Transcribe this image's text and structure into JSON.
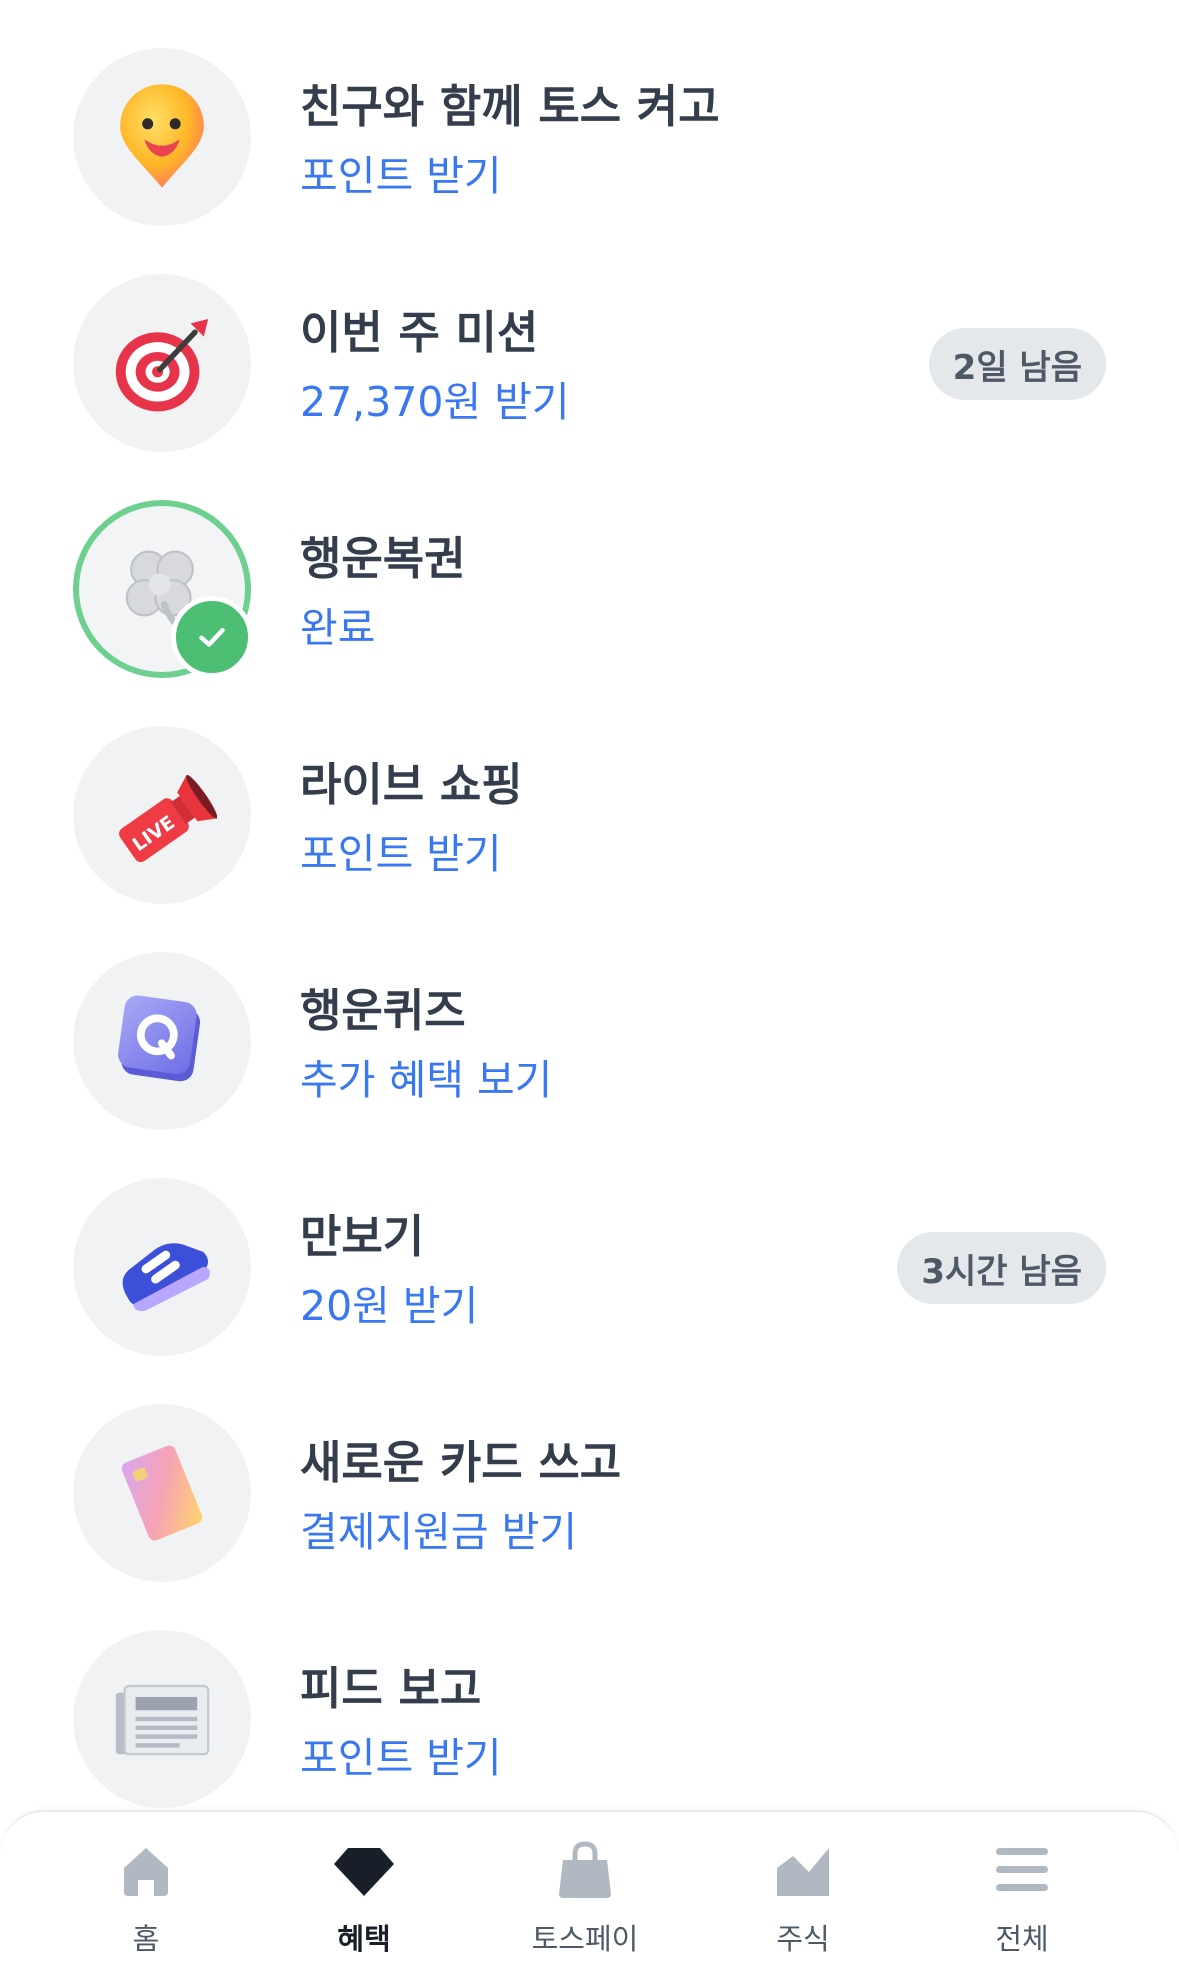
{
  "benefits": [
    {
      "title": "친구와 함께 토스 켜고",
      "subtitle": "포인트 받기",
      "icon": "smile-pin-icon"
    },
    {
      "title": "이번 주 미션",
      "subtitle": "27,370원 받기",
      "badge": "2일 남음",
      "icon": "target-icon"
    },
    {
      "title": "행운복권",
      "subtitle": "완료",
      "icon": "clover-icon",
      "completed": true
    },
    {
      "title": "라이브 쇼핑",
      "subtitle": "포인트 받기",
      "icon": "live-megaphone-icon"
    },
    {
      "title": "행운퀴즈",
      "subtitle": "추가 혜택 보기",
      "icon": "quiz-cube-icon"
    },
    {
      "title": "만보기",
      "subtitle": "20원 받기",
      "badge": "3시간 남음",
      "icon": "sneaker-icon"
    },
    {
      "title": "새로운 카드 쓰고",
      "subtitle": "결제지원금 받기",
      "icon": "card-icon"
    },
    {
      "title": "피드 보고",
      "subtitle": "포인트 받기",
      "icon": "newspaper-icon"
    }
  ],
  "tabbar": {
    "items": [
      {
        "label": "홈",
        "icon": "home-icon"
      },
      {
        "label": "혜택",
        "icon": "diamond-icon",
        "active": true
      },
      {
        "label": "토스페이",
        "icon": "shopping-bag-icon"
      },
      {
        "label": "주식",
        "icon": "chart-icon"
      },
      {
        "label": "전체",
        "icon": "menu-icon"
      }
    ]
  },
  "colors": {
    "accent": "#3a78f2",
    "title": "#333d4b",
    "badge_bg": "#e5e8eb",
    "complete": "#4cbf75",
    "tab_inactive": "#b0b8c1",
    "tab_active": "#191f28"
  }
}
